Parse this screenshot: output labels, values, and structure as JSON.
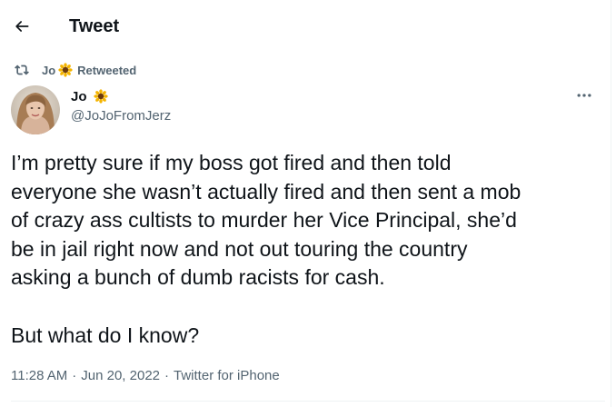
{
  "header": {
    "title": "Tweet",
    "back_icon": "arrow-left-icon"
  },
  "retweet": {
    "name": "Jo",
    "emoji": "sunflower",
    "suffix": "Retweeted",
    "icon": "retweet-icon"
  },
  "author": {
    "name": "Jo",
    "emoji": "sunflower",
    "handle": "@JoJoFromJerz",
    "avatar": "profile-photo"
  },
  "tweet": {
    "lines": [
      "I’m pretty sure if my boss got fired and then told",
      "everyone she wasn’t actually fired and then sent a mob",
      "of crazy ass cultists to murder her Vice Principal, she’d",
      "be in jail right now and not out touring the country",
      "asking a bunch of dumb racists for cash.",
      "",
      "But what do I know?"
    ]
  },
  "meta": {
    "time": "11:28 AM",
    "separator": "·",
    "date": "Jun 20, 2022",
    "source": "Twitter for iPhone"
  },
  "colors": {
    "text": "#0f1419",
    "secondary": "#536471",
    "border": "#eff3f4",
    "sunflower_petal": "#f4b400",
    "sunflower_center": "#6d3b0c"
  }
}
